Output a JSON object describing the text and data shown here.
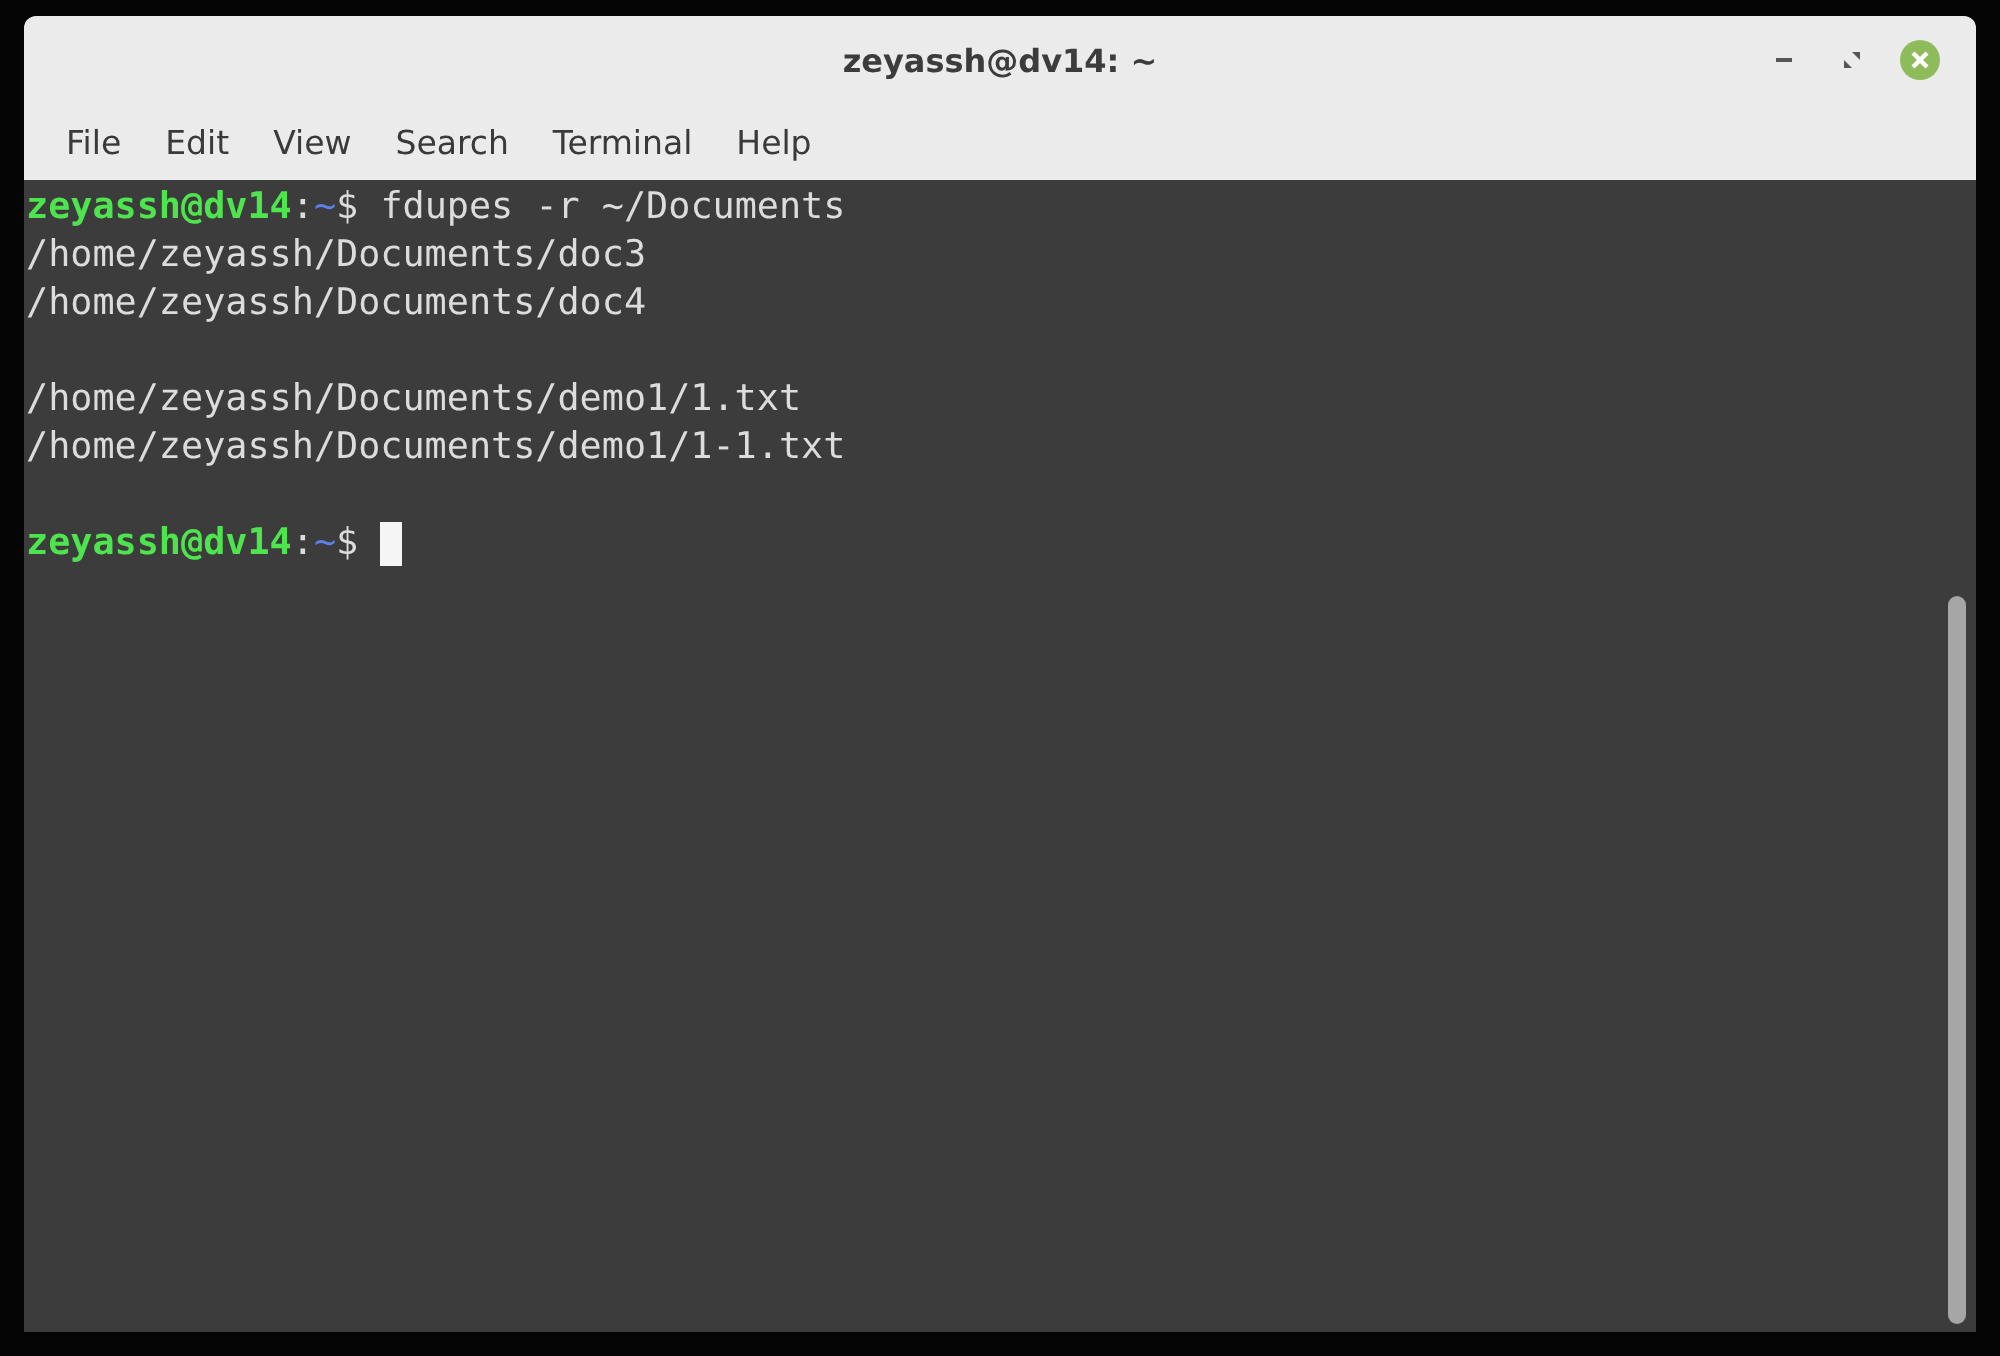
{
  "window": {
    "title": "zeyassh@dv14: ~"
  },
  "menu": [
    "File",
    "Edit",
    "View",
    "Search",
    "Terminal",
    "Help"
  ],
  "terminal": {
    "lines": [
      {
        "kind": "prompt",
        "user": "zeyassh@dv14",
        "sep": ":",
        "path": "~",
        "symbol": "$",
        "command": "fdupes -r ~/Documents",
        "cursor": false
      },
      {
        "kind": "output",
        "text": "/home/zeyassh/Documents/doc3"
      },
      {
        "kind": "output",
        "text": "/home/zeyassh/Documents/doc4"
      },
      {
        "kind": "blank"
      },
      {
        "kind": "output",
        "text": "/home/zeyassh/Documents/demo1/1.txt"
      },
      {
        "kind": "output",
        "text": "/home/zeyassh/Documents/demo1/1-1.txt"
      },
      {
        "kind": "blank"
      },
      {
        "kind": "prompt",
        "user": "zeyassh@dv14",
        "sep": ":",
        "path": "~",
        "symbol": "$",
        "cursor": true
      }
    ]
  }
}
